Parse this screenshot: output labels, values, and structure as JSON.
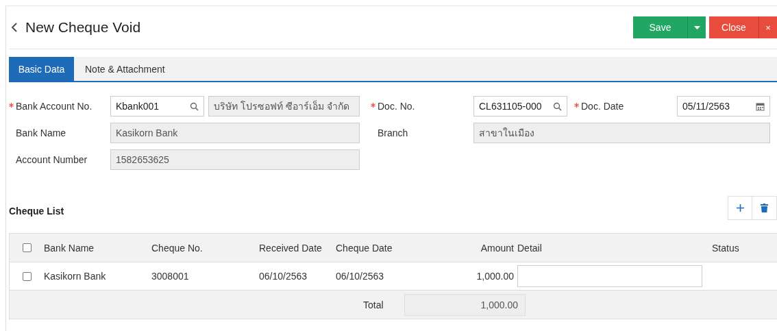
{
  "header": {
    "title": "New Cheque Void",
    "buttons": [
      {
        "label": "Save",
        "kind": "save"
      },
      {
        "label": "Close",
        "kind": "close",
        "close_mark": "×"
      }
    ]
  },
  "tabs": [
    {
      "label": "Basic Data",
      "selected": true
    },
    {
      "label": "Note & Attachment",
      "selected": false
    }
  ],
  "form": {
    "bank_account_no": {
      "label": "Bank Account No.",
      "required": true,
      "value": "Kbank001",
      "company": "บริษัท โปรซอฟท์ ซีอาร์เอ็ม จำกัด"
    },
    "doc_no": {
      "label": "Doc. No.",
      "required": true,
      "value": "CL631105-000"
    },
    "doc_date": {
      "label": "Doc. Date",
      "required": true,
      "value": "05/11/2563"
    },
    "bank_name": {
      "label": "Bank Name",
      "required": false,
      "value": "Kasikorn Bank"
    },
    "branch": {
      "label": "Branch",
      "required": false,
      "value": "สาขาในเมือง"
    },
    "account_number": {
      "label": "Account Number",
      "required": false,
      "value": "1582653625"
    }
  },
  "cheque_list": {
    "title": "Cheque List",
    "select_all_checked": false,
    "columns": [
      "Bank Name",
      "Cheque No.",
      "Received Date",
      "Cheque Date",
      "Amount",
      "Detail",
      "Status"
    ],
    "rows": [
      {
        "checked": false,
        "bank_name": "Kasikorn Bank",
        "cheque_no": "3008001",
        "received_date": "06/10/2563",
        "cheque_date": "06/10/2563",
        "amount": "1,000.00"
      }
    ],
    "total_label": "Total",
    "total": "1,000.00"
  }
}
